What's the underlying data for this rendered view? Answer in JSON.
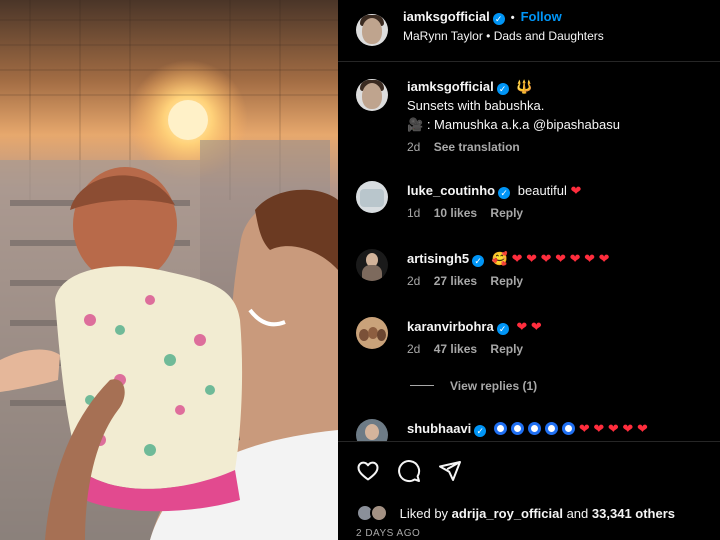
{
  "header": {
    "username": "iamksgofficial",
    "separator": "•",
    "follow_label": "Follow",
    "audio": "MaRynn Taylor",
    "audio_sep": "•",
    "audio_track": "Dads and Daughters"
  },
  "caption": {
    "username": "iamksgofficial",
    "emoji": "🔱",
    "line1": "Sunsets with babushka.",
    "line2_icon": "🎥",
    "line2": ": Mamushka a.k.a @bipashabasu",
    "time": "2d",
    "see_translation": "See translation"
  },
  "comments": [
    {
      "username": "luke_coutinho",
      "verified": true,
      "text": "beautiful",
      "hearts": 1,
      "time": "1d",
      "likes": "10 likes",
      "reply": "Reply"
    },
    {
      "username": "artisingh5",
      "verified": true,
      "emoji": "🥰",
      "hearts": 7,
      "time": "2d",
      "likes": "27 likes",
      "reply": "Reply"
    },
    {
      "username": "karanvirbohra",
      "verified": true,
      "hearts": 2,
      "time": "2d",
      "likes": "47 likes",
      "reply": "Reply"
    },
    {
      "username": "shubhaavi",
      "verified": true,
      "rings": 5,
      "hearts": 5
    }
  ],
  "view_replies": "View replies (1)",
  "verified_mark": "✓",
  "heart_glyph": "❤",
  "likes_bar": {
    "prefix": "Liked by",
    "user": "adrija_roy_official",
    "middle": "and",
    "count": "33,341 others"
  },
  "post_time": "2 DAYS AGO",
  "icons": [
    "heart-icon",
    "comment-icon",
    "share-icon"
  ],
  "colors": {
    "accent": "#0095f6",
    "heart": "#ff2d3d",
    "muted": "#a8a8a8"
  }
}
